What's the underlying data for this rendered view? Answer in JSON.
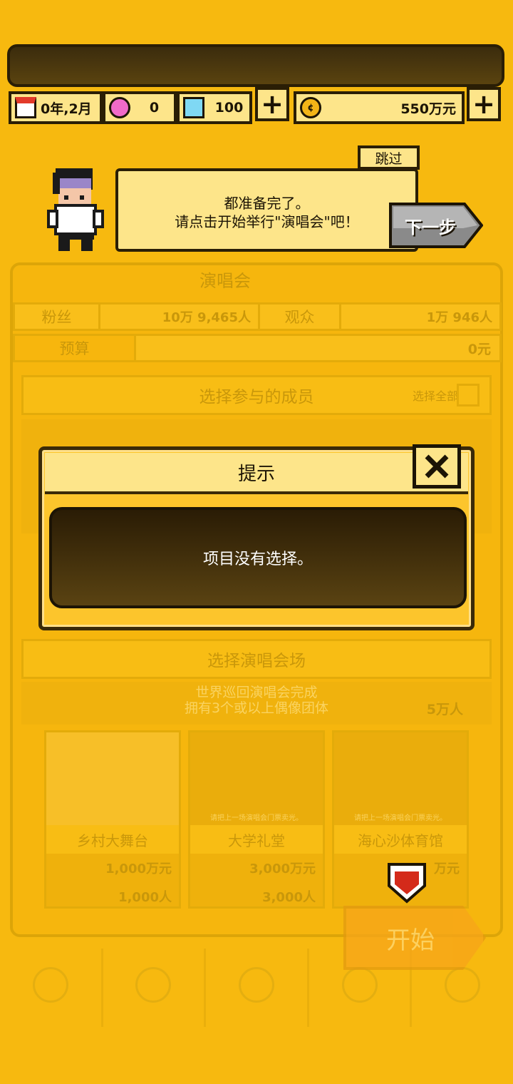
{
  "hud": {
    "date": "0年,2月",
    "fans_item": "0",
    "diamonds": "100",
    "money": "550万元"
  },
  "tutorial": {
    "skip_label": "跳过",
    "message_line1": "都准备完了。",
    "message_line2": "请点击开始举行\"演唱会\"吧！",
    "next_label": "下一步"
  },
  "concert_panel": {
    "title": "演唱会",
    "fans_label": "粉丝",
    "fans_value": "10万 9,465人",
    "audience_label": "观众",
    "audience_value": "1万 946人",
    "budget_label": "预算",
    "budget_value": "0元",
    "members_title": "选择参与的成员",
    "select_all_label": "选择全部",
    "venue_title": "选择演唱会场",
    "venue_banner_line1": "世界巡回演唱会完成",
    "venue_banner_line2": "拥有3个或以上偶像团体",
    "venue_banner_capacity": "5万人",
    "venues": [
      {
        "name": "乡村大舞台",
        "cost": "1,000万元",
        "capacity": "1,000人",
        "lock_note": ""
      },
      {
        "name": "大学礼堂",
        "cost": "3,000万元",
        "capacity": "3,000人",
        "lock_note": "请把上一场演唱会门票卖光。"
      },
      {
        "name": "海心沙体育馆",
        "cost": "万元",
        "capacity": "",
        "lock_note": "请把上一场演唱会门票卖光。"
      }
    ],
    "start_label": "开始"
  },
  "dialog": {
    "title": "提示",
    "message": "项目没有选择。"
  },
  "colors": {
    "background": "#f7b90f",
    "panel_light": "#fde58a",
    "outline": "#2a1e05",
    "dialog_body": "#3b2a0a",
    "next_button": "#8a8a8a",
    "heart": "#d42a1a"
  }
}
